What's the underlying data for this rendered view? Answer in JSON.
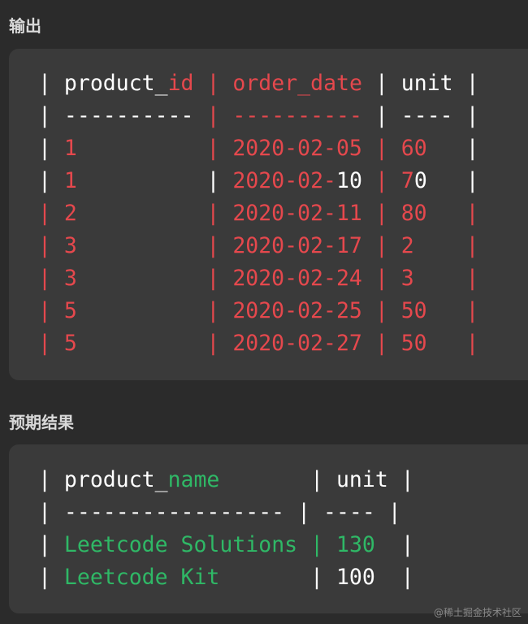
{
  "output": {
    "title": "输出",
    "lines": [
      [
        {
          "t": "| ",
          "c": "w"
        },
        {
          "t": "product_",
          "c": "w"
        },
        {
          "t": "id",
          "c": "r"
        },
        {
          "t": " ",
          "c": "w"
        },
        {
          "t": "|",
          "c": "r"
        },
        {
          "t": " ",
          "c": "w"
        },
        {
          "t": "order_date",
          "c": "r"
        },
        {
          "t": " | unit |",
          "c": "w"
        }
      ],
      [
        {
          "t": "| ",
          "c": "w"
        },
        {
          "t": "----------",
          "c": "w"
        },
        {
          "t": " ",
          "c": "w"
        },
        {
          "t": "|",
          "c": "r"
        },
        {
          "t": " ",
          "c": "w"
        },
        {
          "t": "-",
          "c": "r"
        },
        {
          "t": "---------",
          "c": "r"
        },
        {
          "t": " | ---- |",
          "c": "w"
        }
      ],
      [
        {
          "t": "| ",
          "c": "w"
        },
        {
          "t": "1",
          "c": "r"
        },
        {
          "t": "          | ",
          "c": "r"
        },
        {
          "t": "2020-02-05",
          "c": "r"
        },
        {
          "t": " ",
          "c": "w"
        },
        {
          "t": "|",
          "c": "r"
        },
        {
          "t": " ",
          "c": "w"
        },
        {
          "t": "60",
          "c": "r"
        },
        {
          "t": "   |",
          "c": "w"
        }
      ],
      [
        {
          "t": "| ",
          "c": "w"
        },
        {
          "t": "1",
          "c": "r"
        },
        {
          "t": "          ",
          "c": "w"
        },
        {
          "t": "|",
          "c": "w"
        },
        {
          "t": " ",
          "c": "w"
        },
        {
          "t": "2020-02-",
          "c": "r"
        },
        {
          "t": "10",
          "c": "w"
        },
        {
          "t": " ",
          "c": "w"
        },
        {
          "t": "|",
          "c": "r"
        },
        {
          "t": " ",
          "c": "w"
        },
        {
          "t": "7",
          "c": "r"
        },
        {
          "t": "0",
          "c": "w"
        },
        {
          "t": "   |",
          "c": "w"
        }
      ],
      [
        {
          "t": "| 2          | 2020-02-11 | 80   |",
          "c": "r"
        }
      ],
      [
        {
          "t": "| 3          | 2020-02-17 | 2    |",
          "c": "r"
        }
      ],
      [
        {
          "t": "| 3          | 2020-02-24 | 3    |",
          "c": "r"
        }
      ],
      [
        {
          "t": "| 5          | 2020-02-25 | 50   |",
          "c": "r"
        }
      ],
      [
        {
          "t": "| 5          | 2020-02-27 | 50   |",
          "c": "r"
        }
      ]
    ]
  },
  "expected": {
    "title": "预期结果",
    "lines": [
      [
        {
          "t": "| ",
          "c": "w"
        },
        {
          "t": "product_",
          "c": "w"
        },
        {
          "t": "name",
          "c": "g"
        },
        {
          "t": "       | unit |",
          "c": "w"
        }
      ],
      [
        {
          "t": "| ----------------- | ---- |",
          "c": "w"
        }
      ],
      [
        {
          "t": "| ",
          "c": "w"
        },
        {
          "t": "Leetcode Solutions",
          "c": "g"
        },
        {
          "t": " ",
          "c": "w"
        },
        {
          "t": "|",
          "c": "g"
        },
        {
          "t": " ",
          "c": "w"
        },
        {
          "t": "130",
          "c": "g"
        },
        {
          "t": "  |",
          "c": "w"
        }
      ],
      [
        {
          "t": "| ",
          "c": "w"
        },
        {
          "t": "Leetcode Kit",
          "c": "g"
        },
        {
          "t": "       | 100  |",
          "c": "w"
        }
      ]
    ]
  },
  "watermark": "@稀土掘金技术社区"
}
